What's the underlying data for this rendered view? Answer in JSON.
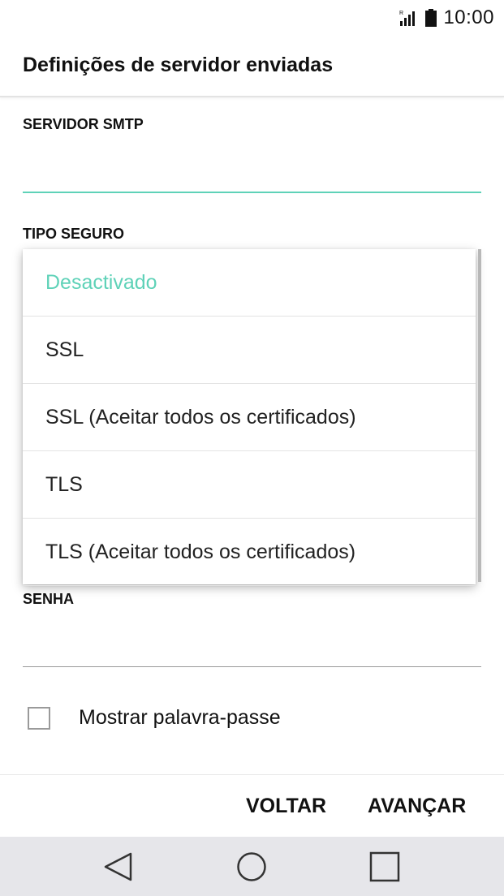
{
  "status_bar": {
    "time": "10:00",
    "signal_icon": "signal-roaming-icon",
    "battery_icon": "battery-icon"
  },
  "app_bar": {
    "title": "Definições de servidor enviadas"
  },
  "form": {
    "smtp_label": "SERVIDOR SMTP",
    "smtp_value": "",
    "security_label": "TIPO SEGURO",
    "password_label": "SENHA",
    "password_value": "",
    "show_password_label": "Mostrar palavra-passe",
    "show_password_checked": false
  },
  "dropdown": {
    "selected_index": 0,
    "options": [
      "Desactivado",
      "SSL",
      "SSL (Aceitar todos os certificados)",
      "TLS",
      "TLS (Aceitar todos os certificados)"
    ]
  },
  "buttons": {
    "back": "VOLTAR",
    "next": "AVANÇAR"
  },
  "nav_bar": {
    "back_icon": "triangle-back-icon",
    "home_icon": "circle-home-icon",
    "recent_icon": "square-recent-icon"
  },
  "colors": {
    "accent": "#5fd2b8",
    "nav_background": "#e6e6ea"
  }
}
